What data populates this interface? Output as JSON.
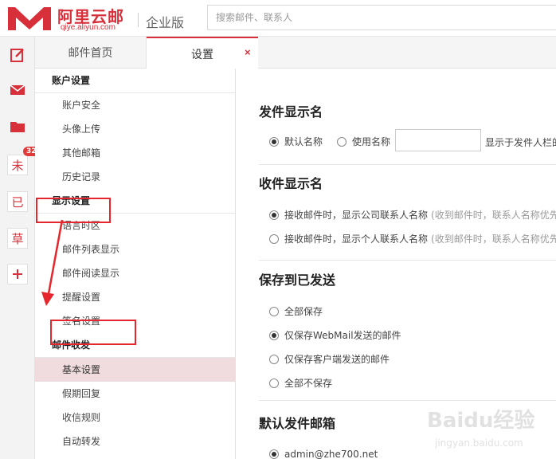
{
  "header": {
    "logo_text": "阿里云邮",
    "logo_subtext": "qiye.aliyun.com",
    "edition": "企业版",
    "search_placeholder": "搜索邮件、联系人"
  },
  "rail": {
    "compose_icon": "compose-icon",
    "inbox_icon": "mail-icon",
    "folder_icon": "folder-icon",
    "unread_label": "未",
    "unread_count": "32",
    "sent_label": "已",
    "draft_label": "草",
    "add_icon": "plus-icon"
  },
  "tabs": {
    "home": "邮件首页",
    "settings": "设置",
    "close": "×"
  },
  "nav": {
    "account_group": "账户设置",
    "account_items": [
      "账户安全",
      "头像上传",
      "其他邮箱",
      "历史记录"
    ],
    "display_group": "显示设置",
    "display_items": [
      "语言时区",
      "邮件列表显示",
      "邮件阅读显示",
      "提醒设置",
      "签名设置"
    ],
    "mail_group": "邮件收发",
    "mail_items": [
      "基本设置",
      "假期回复",
      "收信规则",
      "自动转发"
    ]
  },
  "main": {
    "sender_title": "发件显示名",
    "sender_default": "默认名称",
    "sender_custom": "使用名称",
    "sender_suffix": "显示于发件人栏的",
    "receiver_title": "收件显示名",
    "receiver_opt1": "接收邮件时，显示公司联系人名称",
    "receiver_opt1_hint": "(收到邮件时，联系人名称优先",
    "receiver_opt2": "接收邮件时，显示个人联系人名称",
    "receiver_opt2_hint": "(收到邮件时，联系人名称优先",
    "save_title": "保存到已发送",
    "save_opts": [
      "全部保存",
      "仅保存WebMail发送的邮件",
      "仅保存客户端发送的邮件",
      "全部不保存"
    ],
    "default_sender_title": "默认发件邮箱",
    "default_sender_email": "admin@zhe700.net"
  },
  "watermark": {
    "brand": "Baidu经验",
    "url": "jingyan.baidu.com"
  },
  "colors": {
    "accent": "#d7303a",
    "annotation": "#e5262d",
    "active_nav": "#f0dcdf"
  }
}
